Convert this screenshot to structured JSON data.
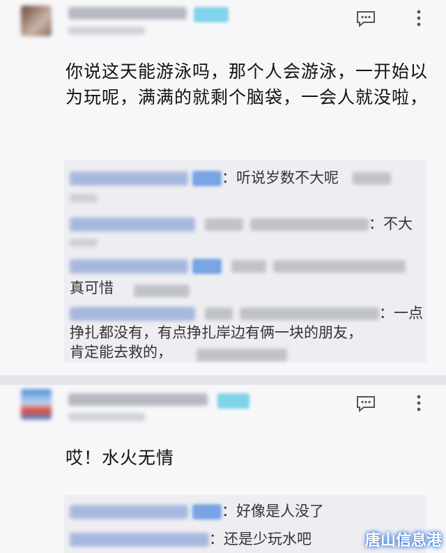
{
  "comment1": {
    "text": "你说这天能游泳吗，那个人会游泳，一开始以为玩呢，满满的就剩个脑袋，一会人就没啦，",
    "replies": [
      {
        "text": "：听说岁数不大呢"
      },
      {
        "text": "：不大"
      },
      {
        "text": "真可惜"
      },
      {
        "text": "：一点"
      },
      {
        "text": "挣扎都没有，有点挣扎岸边有俩一块的朋友，"
      },
      {
        "text": "肯定能去救的，"
      }
    ]
  },
  "comment2": {
    "text": "哎！水火无情",
    "replies": [
      {
        "text": "：好像是人没了"
      },
      {
        "text": "：还是少玩水吧"
      }
    ]
  },
  "icons": {
    "comment": "comment-icon",
    "more": "more-vert-icon"
  },
  "watermark": "唐山信息港"
}
